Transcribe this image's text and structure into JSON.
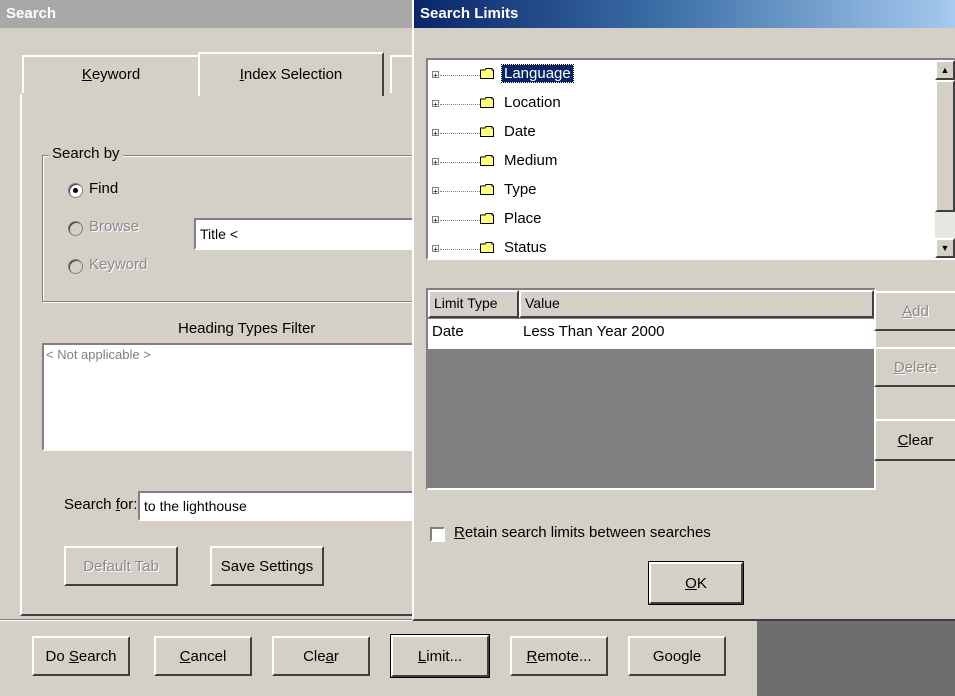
{
  "search_window": {
    "title": "Search",
    "tabs": [
      {
        "label": "Keyword",
        "mnemonic": "K",
        "rest": "eyword"
      },
      {
        "label": "Index Selection",
        "mnemonic": "I",
        "rest": "ndex Selection"
      }
    ],
    "search_by": {
      "legend": "Search by",
      "options": [
        {
          "label": "Find",
          "checked": true,
          "enabled": true
        },
        {
          "label": "Browse",
          "checked": false,
          "enabled": false
        },
        {
          "label": "Keyword",
          "checked": false,
          "enabled": false
        }
      ],
      "browse_field_value": "Title <"
    },
    "heading_types_filter": {
      "label": "Heading Types Filter",
      "placeholder": "< Not applicable >"
    },
    "search_for": {
      "label_pre": "Search ",
      "label_mnemonic": "f",
      "label_post": "or:",
      "value": "to the lighthouse"
    },
    "buttons": {
      "default_tab": "Default Tab",
      "save_settings": "Save Settings"
    },
    "bottom_buttons": [
      {
        "pre": "Do ",
        "mn": "S",
        "post": "earch"
      },
      {
        "pre": "",
        "mn": "C",
        "post": "ancel"
      },
      {
        "pre": "Cle",
        "mn": "a",
        "post": "r"
      },
      {
        "pre": "",
        "mn": "L",
        "post": "imit..."
      },
      {
        "pre": "",
        "mn": "R",
        "post": "emote..."
      },
      {
        "pre": "",
        "mn": "",
        "post": "Google"
      }
    ]
  },
  "limits_dialog": {
    "title": "Search Limits",
    "tree_items": [
      "Language",
      "Location",
      "Date",
      "Medium",
      "Type",
      "Place",
      "Status"
    ],
    "selected_tree_item": "Language",
    "table": {
      "columns": [
        "Limit Type",
        "Value"
      ],
      "rows": [
        {
          "limit_type": "Date",
          "value": "Less Than Year 2000"
        }
      ]
    },
    "side_buttons": [
      {
        "mn": "A",
        "post": "dd",
        "enabled": false
      },
      {
        "mn": "D",
        "post": "elete",
        "enabled": false
      },
      {
        "mn": "C",
        "post": "lear",
        "enabled": true
      }
    ],
    "retain_checkbox": {
      "mn": "R",
      "post": "etain search limits between searches",
      "checked": false
    },
    "ok_button": {
      "mn": "O",
      "post": "K"
    }
  },
  "colors": {
    "face": "#d4d0c8",
    "active_title_start": "#0a246a",
    "active_title_end": "#a6caf0",
    "inactive_title": "#a8a8a8",
    "list_empty_area": "#808080"
  }
}
